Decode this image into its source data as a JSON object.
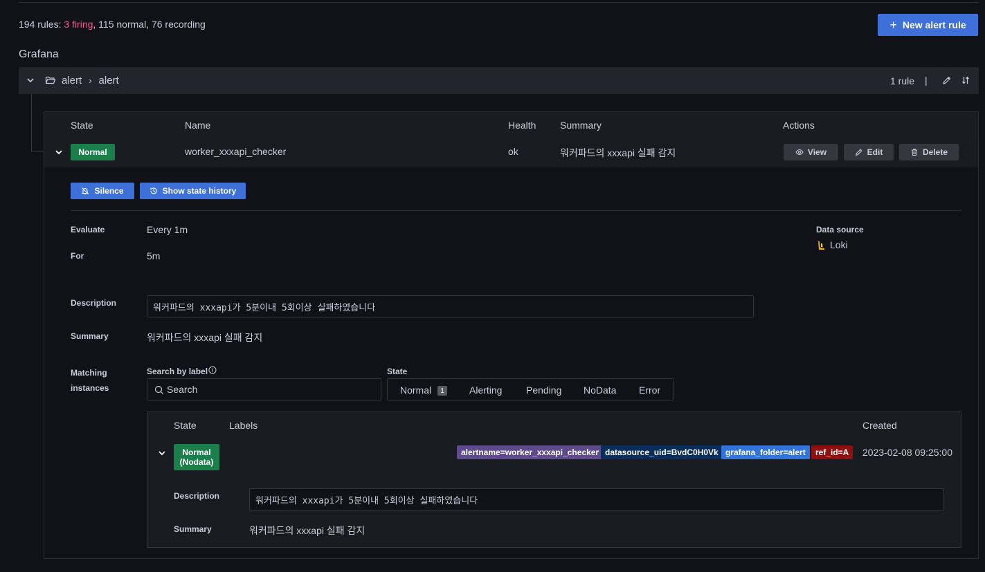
{
  "stats": {
    "total": "194 rules:",
    "firing": "3 firing",
    "rest_normal": ", 115 normal",
    "rest_recording": ", 76 recording"
  },
  "new_rule_label": "New alert rule",
  "section_title": "Grafana",
  "folder": {
    "crumb_a": "alert",
    "crumb_sep": "›",
    "crumb_b": "alert",
    "rule_count": "1 rule",
    "pipe": "|"
  },
  "rules_table": {
    "headers": {
      "state": "State",
      "name": "Name",
      "health": "Health",
      "summary": "Summary",
      "actions": "Actions"
    },
    "row": {
      "state": "Normal",
      "name": "worker_xxxapi_checker",
      "health": "ok",
      "summary": "워커파드의 xxxapi 실패 감지"
    },
    "actions": {
      "view": "View",
      "edit": "Edit",
      "delete": "Delete"
    }
  },
  "detail": {
    "silence_label": "Silence",
    "history_label": "Show state history",
    "evaluate_label": "Evaluate",
    "evaluate_value": "Every 1m",
    "for_label": "For",
    "for_value": "5m",
    "datasource_label": "Data source",
    "datasource_value": "Loki",
    "description_label": "Description",
    "description_value": "워커파드의 xxxapi가 5분이내 5회이상 실패하였습니다",
    "summary_label": "Summary",
    "summary_value": "워커파드의 xxxapi 실패 감지",
    "matching_label_1": "Matching",
    "matching_label_2": "instances",
    "search_label": "Search by label",
    "search_placeholder": "Search",
    "state_label": "State",
    "state_options": [
      "Normal",
      "Alerting",
      "Pending",
      "NoData",
      "Error"
    ],
    "normal_count": "1"
  },
  "instances": {
    "headers": {
      "state": "State",
      "labels": "Labels",
      "created": "Created"
    },
    "row": {
      "state_line1": "Normal",
      "state_line2": "(Nodata)",
      "labels": [
        {
          "text": "alertname=worker_xxxapi_checker",
          "color": "#5f4a8b"
        },
        {
          "text": "datasource_uid=BvdC0H0Vk",
          "color": "#0a2e5c"
        },
        {
          "text": "grafana_folder=alert",
          "color": "#3274d9"
        },
        {
          "text": "ref_id=A",
          "color": "#8f1010"
        }
      ],
      "created": "2023-02-08 09:25:00",
      "description_label": "Description",
      "description_value": "워커파드의 xxxapi가 5분이내 5회이상 실패하였습니다",
      "summary_label": "Summary",
      "summary_value": "워커파드의 xxxapi 실패 감지"
    }
  },
  "colors": {
    "accent": "#3d71d9",
    "firing": "#ff5286",
    "normal": "#1a7f4b"
  }
}
